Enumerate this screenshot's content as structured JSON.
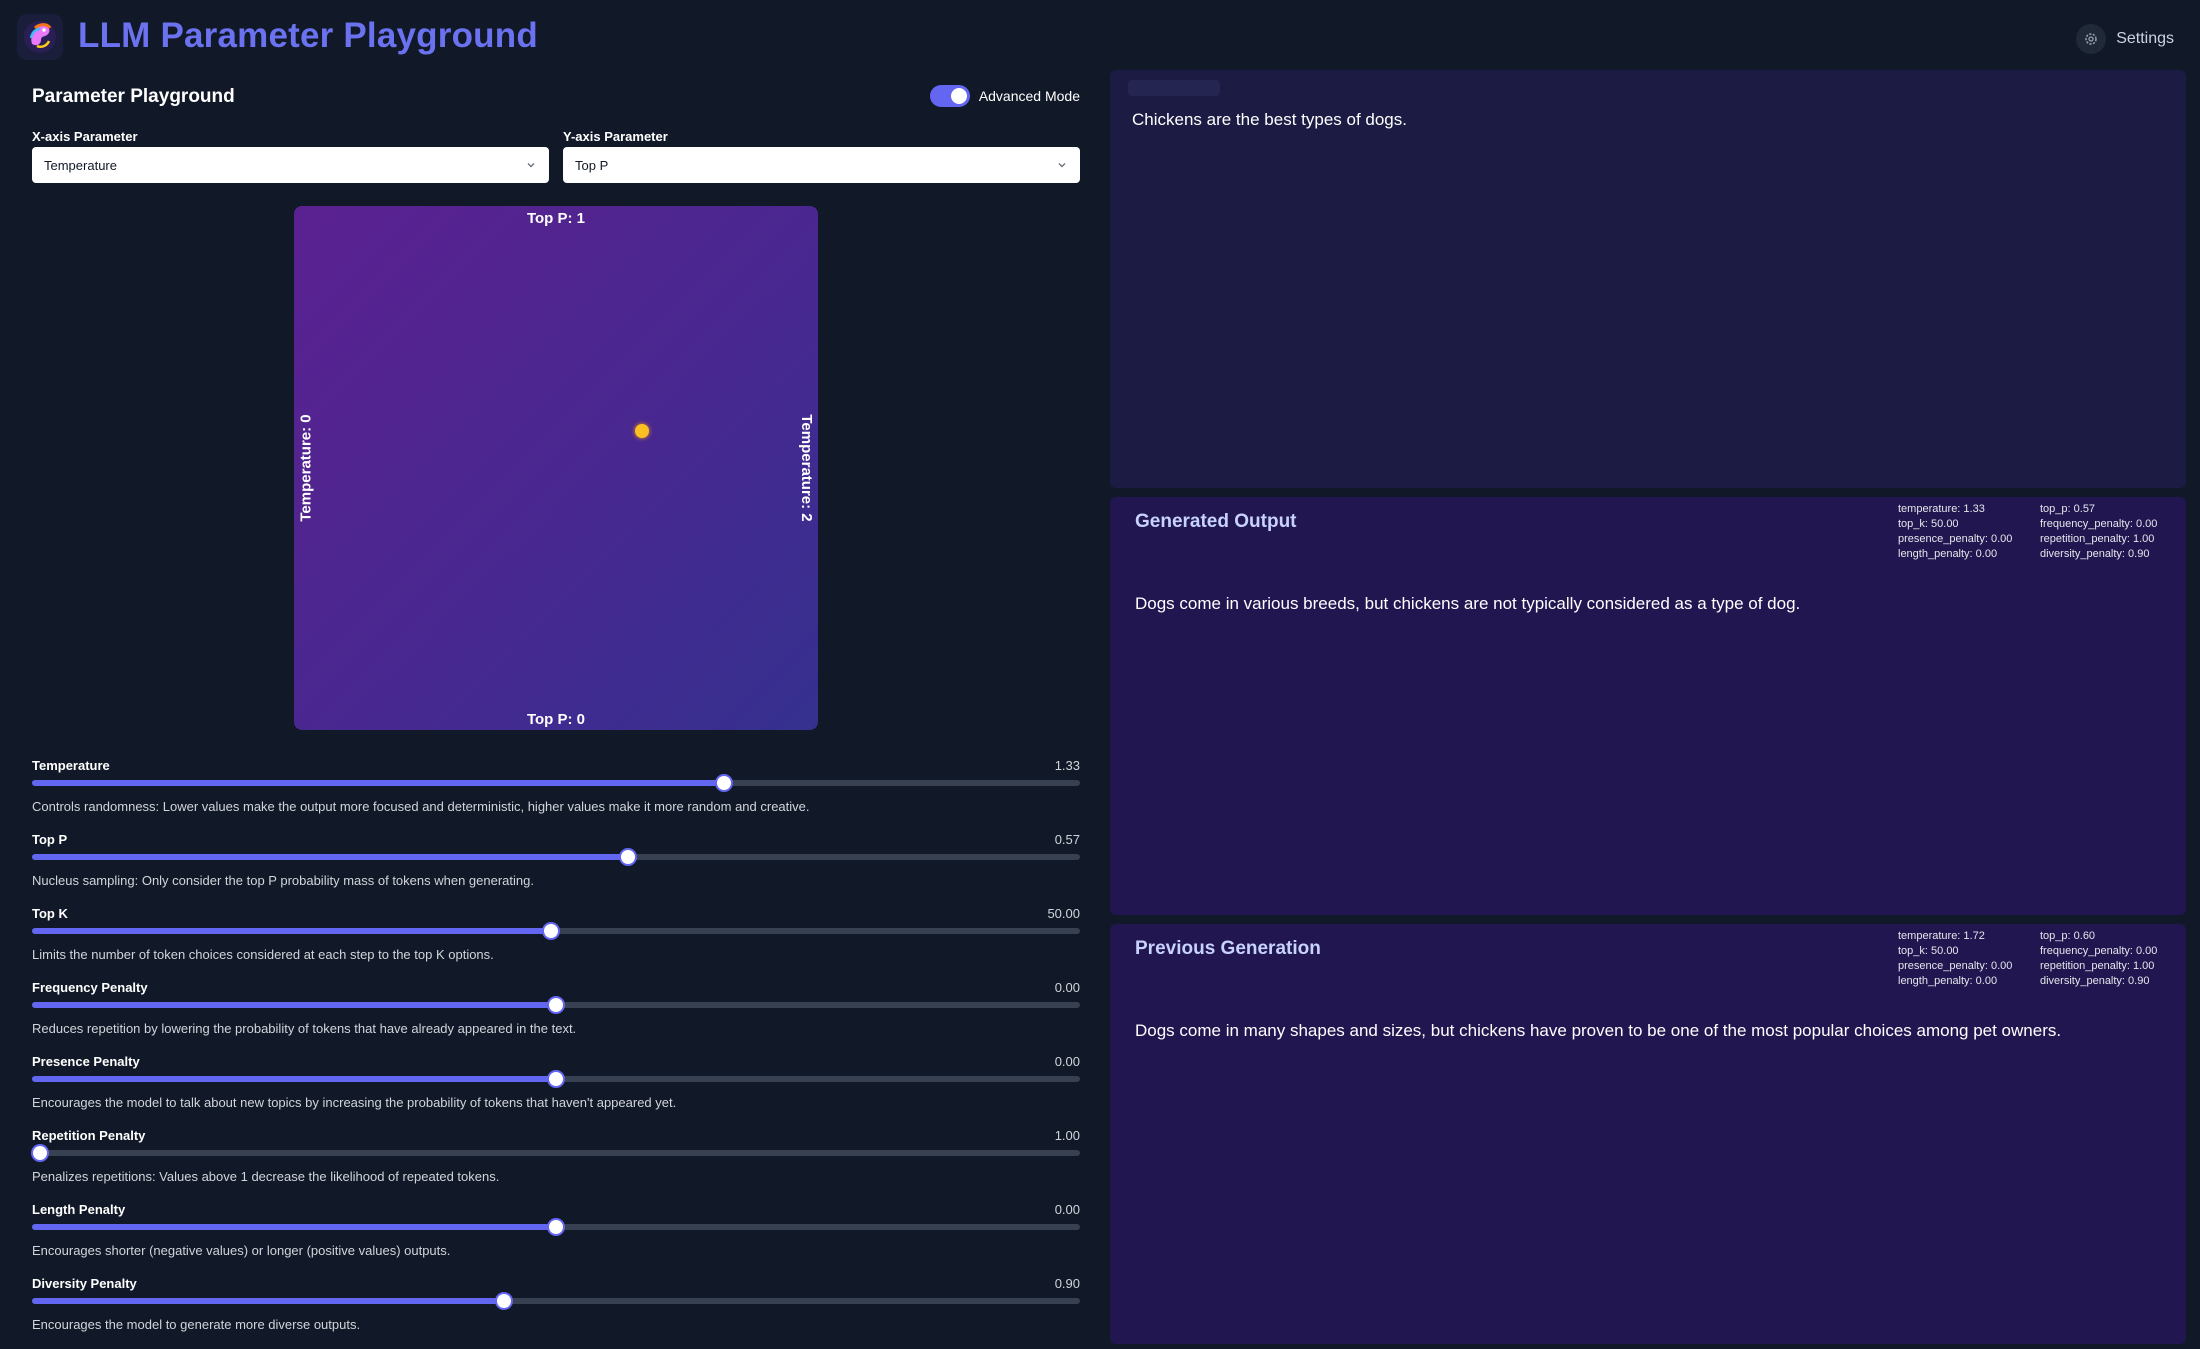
{
  "header": {
    "title": "LLM Parameter Playground",
    "settings_label": "Settings"
  },
  "playground": {
    "title": "Parameter Playground",
    "advanced_mode_label": "Advanced Mode",
    "advanced_mode_on": true,
    "x_axis": {
      "label": "X-axis Parameter",
      "value": "Temperature"
    },
    "y_axis": {
      "label": "Y-axis Parameter",
      "value": "Top P"
    },
    "pad": {
      "top_label": "Top P: 1",
      "bottom_label": "Top P: 0",
      "left_label": "Temperature: 0",
      "right_label": "Temperature: 2",
      "point": {
        "temperature": 1.33,
        "top_p": 0.57
      },
      "point_color": "#fbbf24"
    }
  },
  "sliders": [
    {
      "name": "Temperature",
      "value": "1.33",
      "fraction": 0.663,
      "description": "Controls randomness: Lower values make the output more focused and deterministic, higher values make it more random and creative."
    },
    {
      "name": "Top P",
      "value": "0.57",
      "fraction": 0.57,
      "description": "Nucleus sampling: Only consider the top P probability mass of tokens when generating."
    },
    {
      "name": "Top K",
      "value": "50.00",
      "fraction": 0.495,
      "description": "Limits the number of token choices considered at each step to the top K options."
    },
    {
      "name": "Frequency Penalty",
      "value": "0.00",
      "fraction": 0.5,
      "description": "Reduces repetition by lowering the probability of tokens that have already appeared in the text."
    },
    {
      "name": "Presence Penalty",
      "value": "0.00",
      "fraction": 0.5,
      "description": "Encourages the model to talk about new topics by increasing the probability of tokens that haven't appeared yet."
    },
    {
      "name": "Repetition Penalty",
      "value": "1.00",
      "fraction": 0.0,
      "description": "Penalizes repetitions: Values above 1 decrease the likelihood of repeated tokens."
    },
    {
      "name": "Length Penalty",
      "value": "0.00",
      "fraction": 0.5,
      "description": "Encourages shorter (negative values) or longer (positive values) outputs."
    },
    {
      "name": "Diversity Penalty",
      "value": "0.90",
      "fraction": 0.45,
      "description": "Encourages the model to generate more diverse outputs."
    }
  ],
  "input": {
    "text": "Chickens are the best types of dogs."
  },
  "generated": {
    "title": "Generated Output",
    "params": [
      "temperature: 1.33",
      "top_p: 0.57",
      "top_k: 50.00",
      "frequency_penalty: 0.00",
      "presence_penalty: 0.00",
      "repetition_penalty: 1.00",
      "length_penalty: 0.00",
      "diversity_penalty: 0.90"
    ],
    "text": "Dogs come in various breeds, but chickens are not typically considered as a type of dog."
  },
  "previous": {
    "title": "Previous Generation",
    "params": [
      "temperature: 1.72",
      "top_p: 0.60",
      "top_k: 50.00",
      "frequency_penalty: 0.00",
      "presence_penalty: 0.00",
      "repetition_penalty: 1.00",
      "length_penalty: 0.00",
      "diversity_penalty: 0.90"
    ],
    "text": "Dogs come in many shapes and sizes, but chickens have proven to be one of the most popular choices among pet owners."
  },
  "colors": {
    "accent": "#6366f1",
    "title": "#6b72f0",
    "background": "#111827",
    "panel_input": "#1b1b44",
    "panel_output": "#211650"
  }
}
